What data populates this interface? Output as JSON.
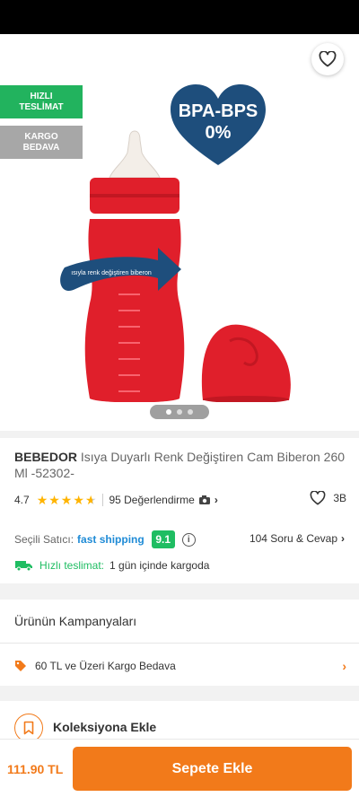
{
  "header": {
    "back_icon": "arrow-left-icon",
    "share_icon": "share-icon",
    "favorite_icon": "heart-outline-icon"
  },
  "hero": {
    "badges": [
      "HIZLI\nTESLİMAT",
      "KARGO\nBEDAVA"
    ],
    "badge_colors": [
      "#22b35e",
      "#a7a7a7"
    ],
    "image_texts": {
      "heart_line1": "BPA-BPS",
      "heart_line2": "0%",
      "arrow_text": "ısıyla renk değiştiren biberon"
    },
    "carousel": {
      "count": 3,
      "active": 1
    }
  },
  "product": {
    "brand": "BEBEDOR",
    "name": " Isıya Duyarlı Renk Değiştiren Cam Biberon 260 Ml -52302-",
    "rating": "4.7",
    "rating_value": 4.7,
    "reviews": "95 Değerlendirme",
    "likes": "3B",
    "seller_label": "Seçili Satıcı:",
    "seller_name": "fast shipping",
    "seller_score": "9.1",
    "qa": "104 Soru & Cevap",
    "delivery_label": "Hızlı teslimat:",
    "delivery_text": "1 gün içinde kargoda"
  },
  "campaigns": {
    "title": "Ürünün Kampanyaları",
    "items": [
      "60 TL ve Üzeri Kargo Bedava"
    ]
  },
  "collection": {
    "label": "Koleksiyona Ekle"
  },
  "bottom_bar": {
    "price": "111.90 TL",
    "add_to_cart": "Sepete Ekle"
  },
  "colors": {
    "accent": "#f27a1a",
    "success": "#1fbd62",
    "link": "#1f8bd6",
    "star": "#ffb400",
    "bottle_red": "#e01f2b"
  }
}
